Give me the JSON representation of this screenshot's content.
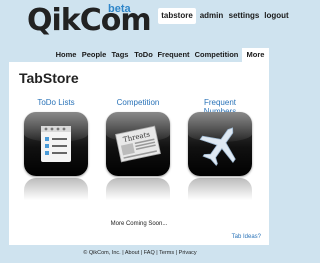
{
  "logo": {
    "text": "QikCom",
    "badge": "beta"
  },
  "topnav": [
    {
      "label": "tabstore",
      "active": true
    },
    {
      "label": "admin",
      "active": false
    },
    {
      "label": "settings",
      "active": false
    },
    {
      "label": "logout",
      "active": false
    }
  ],
  "tabs": [
    {
      "label": "Home",
      "active": false
    },
    {
      "label": "People",
      "active": false
    },
    {
      "label": "Tags",
      "active": false
    },
    {
      "label": "ToDo",
      "active": false
    },
    {
      "label": "Frequent",
      "active": false
    },
    {
      "label": "Competition",
      "active": false
    },
    {
      "label": "More",
      "active": true
    }
  ],
  "page": {
    "title": "TabStore"
  },
  "apps": [
    {
      "label": "ToDo Lists",
      "icon": "checklist-icon"
    },
    {
      "label": "Competition",
      "icon": "newspaper-icon",
      "icon_text": "Threats"
    },
    {
      "label": "Frequent Numbers",
      "icon": "airplane-icon"
    }
  ],
  "more_text": "More Coming Soon...",
  "ideas_link": "Tab Ideas?",
  "footer": {
    "copyright": "© QikCom, Inc.",
    "sep": "|",
    "links": [
      "About",
      "FAQ",
      "Terms",
      "Privacy"
    ]
  },
  "colors": {
    "background": "#cfe3ef",
    "link": "#2a73b8",
    "beta": "#2f86c9"
  }
}
